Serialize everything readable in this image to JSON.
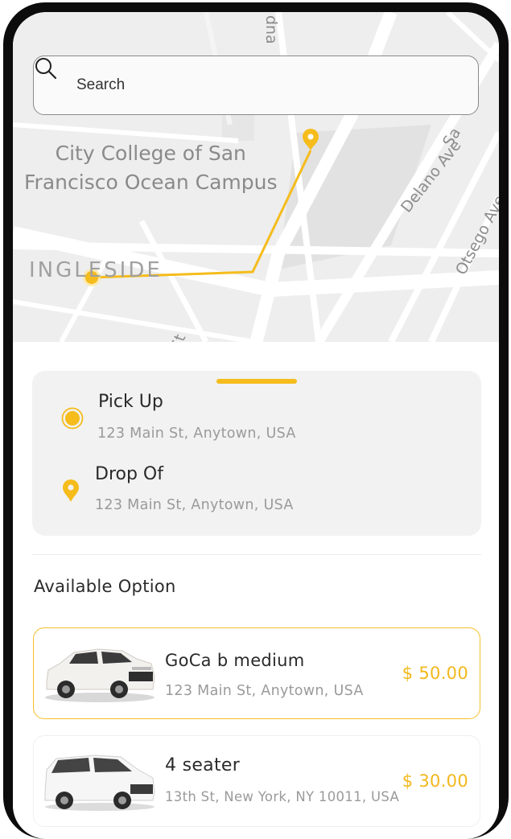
{
  "map": {
    "labels": {
      "campus_line1": "City College of San",
      "campus_line2": "Francisco Ocean Campus",
      "neighborhood": "INGLESIDE",
      "street_delano": "Delano Ave",
      "street_otsego": "Otsego Ave",
      "street_top": "dna",
      "street_sa": "Sa",
      "street_st": "St"
    },
    "route_color": "#f5bc1c"
  },
  "search": {
    "placeholder": "Search",
    "icon": "search-icon"
  },
  "trip": {
    "pickup": {
      "title": "Pick Up",
      "address": "123 Main St, Anytown, USA",
      "icon": "pickup-dot-icon"
    },
    "dropoff": {
      "title": "Drop Of",
      "address": "123 Main St, Anytown, USA",
      "icon": "location-pin-icon"
    }
  },
  "options_section": {
    "title": "Available Option",
    "options": [
      {
        "name": "GoCa b medium",
        "address": "123 Main St, Anytown, USA",
        "price": "$ 50.00",
        "selected": true,
        "image": "white-suv"
      },
      {
        "name": "4 seater",
        "address": "13th St, New York, NY 10011, USA",
        "price": "$ 30.00",
        "selected": false,
        "image": "white-minivan"
      }
    ]
  },
  "colors": {
    "accent": "#f5bc1c",
    "card_bg": "#f2f2f2",
    "map_bg": "#eeeeee"
  }
}
